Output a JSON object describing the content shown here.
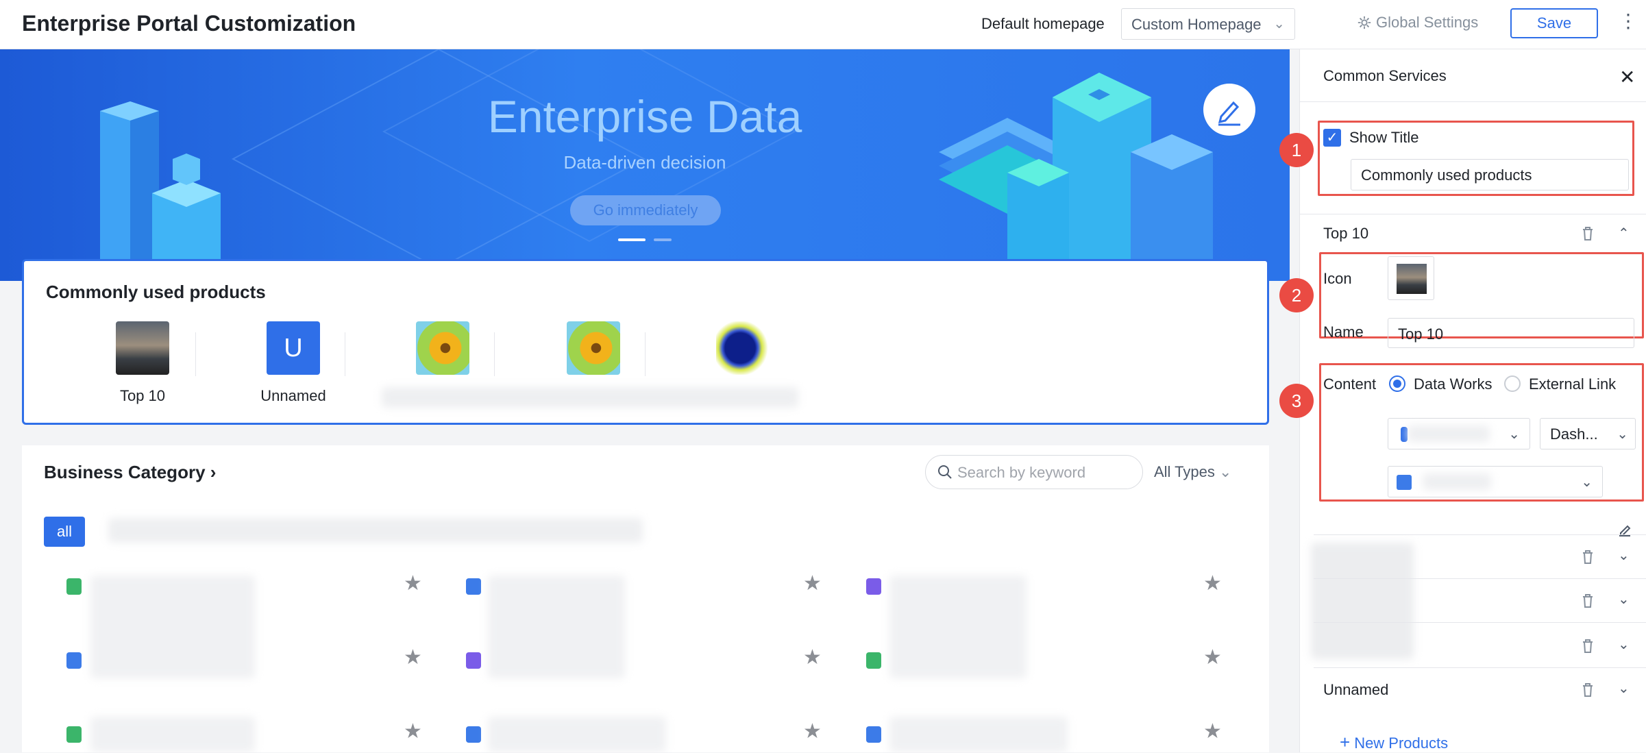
{
  "header": {
    "title": "Enterprise Portal Customization",
    "default_homepage_label": "Default homepage",
    "homepage_select_value": "Custom Homepage",
    "global_settings": "Global Settings",
    "save": "Save"
  },
  "banner": {
    "title": "Enterprise Data",
    "subtitle": "Data-driven decision",
    "button": "Go immediately"
  },
  "products": {
    "title": "Commonly used products",
    "items": [
      {
        "name": "Top 10"
      },
      {
        "name": "Unnamed",
        "letter": "U"
      },
      {
        "name": ""
      },
      {
        "name": ""
      },
      {
        "name": ""
      }
    ]
  },
  "business": {
    "title": "Business Category",
    "search_placeholder": "Search by keyword",
    "types": "All Types",
    "all": "all"
  },
  "panel": {
    "title": "Common Services",
    "show_title": "Show Title",
    "title_value": "Commonly used products",
    "section_top10": "Top 10",
    "icon_label": "Icon",
    "name_label": "Name",
    "name_value": "Top 10",
    "content_label": "Content",
    "radio_data_works": "Data Works",
    "radio_external": "External Link",
    "dash_select": "Dash...",
    "section_unnamed": "Unnamed",
    "new_products": "New Products"
  },
  "annotations": [
    "1",
    "2",
    "3"
  ],
  "colors": {
    "accent": "#2f6fe8",
    "highlight": "#e8554d",
    "banner": "#2f7ff0"
  }
}
